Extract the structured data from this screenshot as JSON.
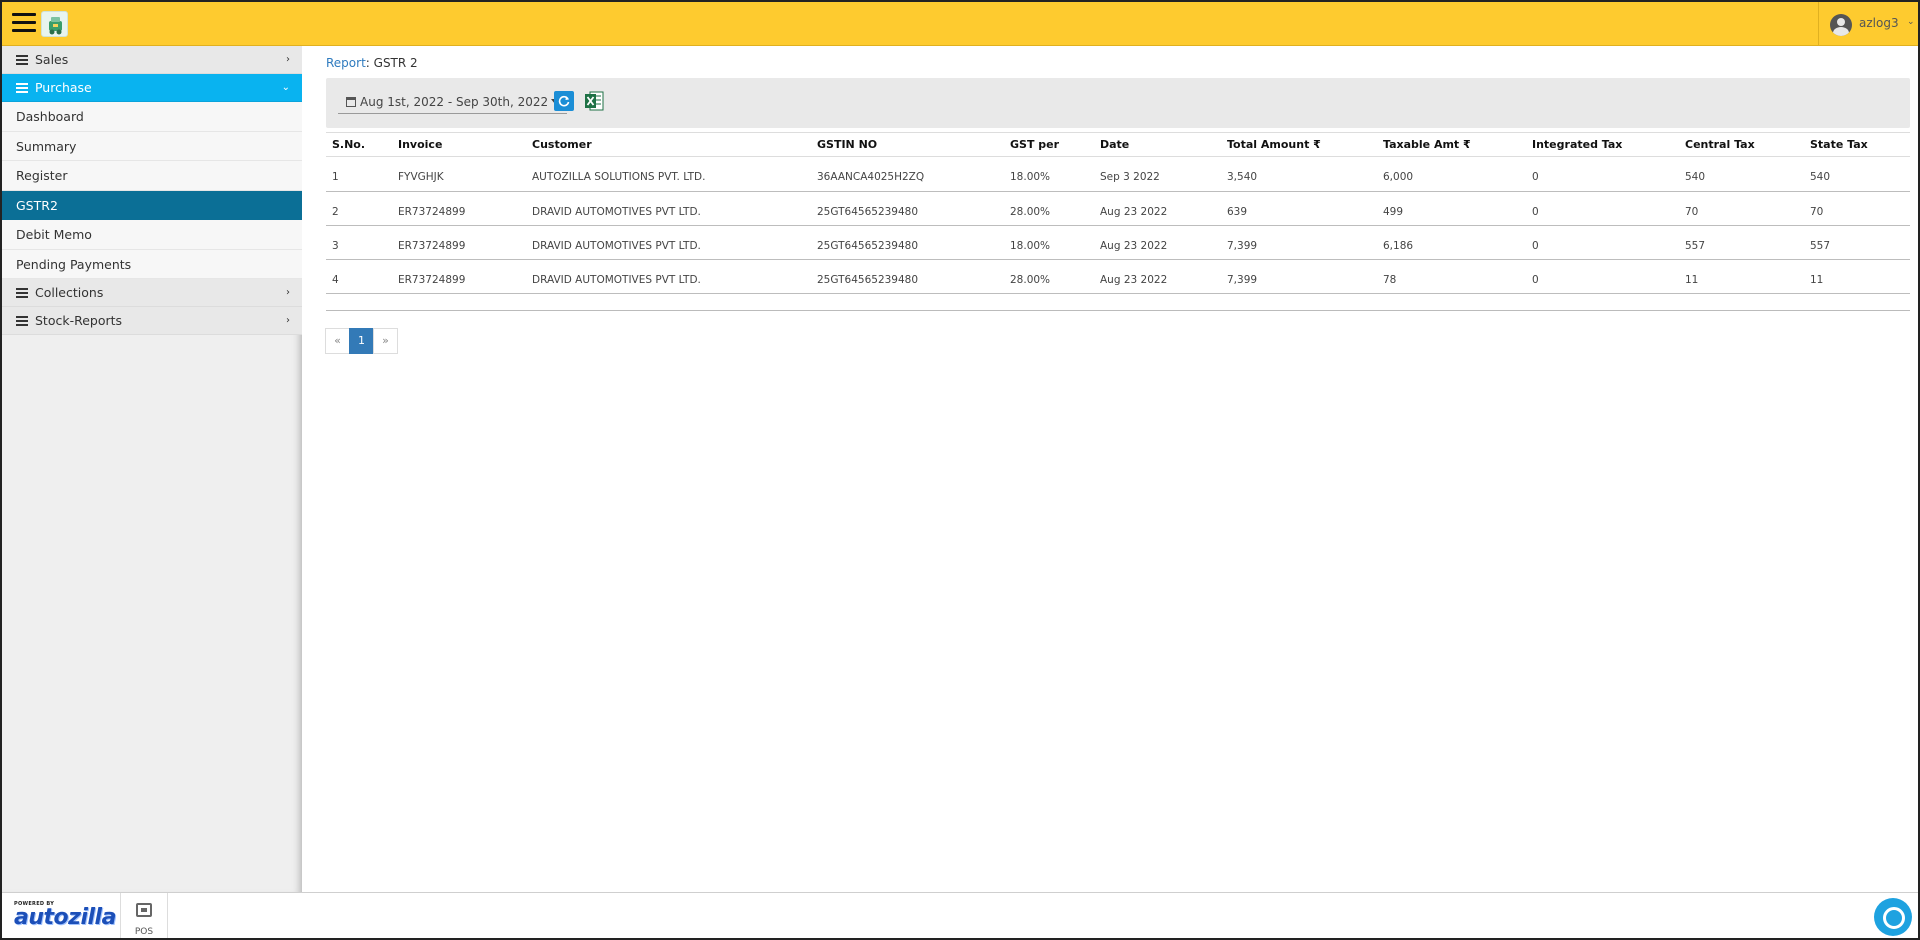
{
  "topbar": {
    "username": "azlog3"
  },
  "sidebar": {
    "groups": [
      {
        "label": "Sales"
      },
      {
        "label": "Purchase"
      },
      {
        "label": "Collections"
      },
      {
        "label": "Stock-Reports"
      }
    ],
    "purchase_items": [
      {
        "label": "Dashboard"
      },
      {
        "label": "Summary"
      },
      {
        "label": "Register"
      },
      {
        "label": "GSTR2"
      },
      {
        "label": "Debit Memo"
      },
      {
        "label": "Pending Payments"
      }
    ]
  },
  "breadcrumb": {
    "link": "Report",
    "separator": ": ",
    "current": "GSTR 2"
  },
  "filters": {
    "date_range": "Aug 1st, 2022 - Sep 30th, 2022"
  },
  "table": {
    "headers": [
      "S.No.",
      "Invoice",
      "Customer",
      "GSTIN NO",
      "GST per",
      "Date",
      "Total Amount ₹",
      "Taxable Amt ₹",
      "Integrated Tax",
      "Central Tax",
      "State Tax"
    ],
    "rows": [
      [
        "1",
        "FYVGHJK",
        "AUTOZILLA SOLUTIONS PVT. LTD.",
        "36AANCA4025H2ZQ",
        "18.00%",
        "Sep 3 2022",
        "3,540",
        "6,000",
        "0",
        "540",
        "540"
      ],
      [
        "2",
        "ER73724899",
        "DRAVID AUTOMOTIVES PVT LTD.",
        "25GT64565239480",
        "28.00%",
        "Aug 23 2022",
        "639",
        "499",
        "0",
        "70",
        "70"
      ],
      [
        "3",
        "ER73724899",
        "DRAVID AUTOMOTIVES PVT LTD.",
        "25GT64565239480",
        "18.00%",
        "Aug 23 2022",
        "7,399",
        "6,186",
        "0",
        "557",
        "557"
      ],
      [
        "4",
        "ER73724899",
        "DRAVID AUTOMOTIVES PVT LTD.",
        "25GT64565239480",
        "28.00%",
        "Aug 23 2022",
        "7,399",
        "78",
        "0",
        "11",
        "11"
      ]
    ]
  },
  "pagination": {
    "prev": "«",
    "current": "1",
    "next": "»"
  },
  "footer": {
    "powered_by": "POWERED BY",
    "brand": "autozilla",
    "pos_label": "POS"
  },
  "colors": {
    "topbar": "#fecb2f",
    "sidebar_active_group": "#09b3f0",
    "sidebar_active_item": "#0b6f96",
    "link": "#2f7bbf",
    "page_active": "#337ab7"
  },
  "icons": {
    "menu": "hamburger-icon",
    "refresh": "refresh-icon",
    "export": "excel-icon",
    "calendar": "calendar-icon",
    "chat": "chat-icon"
  }
}
